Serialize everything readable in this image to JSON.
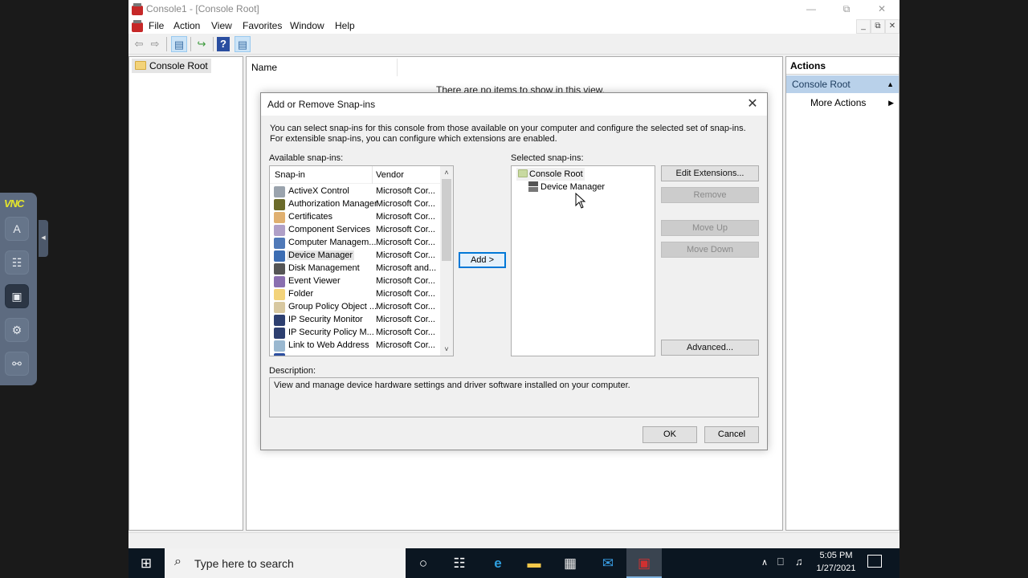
{
  "window": {
    "title": "Console1 - [Console Root]",
    "controls": {
      "minimize": "—",
      "restore": "⧉",
      "close": "✕"
    },
    "mdi_controls": {
      "minimize": "_",
      "restore": "⧉",
      "close": "✕"
    }
  },
  "menubar": [
    "File",
    "Action",
    "View",
    "Favorites",
    "Window",
    "Help"
  ],
  "toolbar": {
    "back": "⇦",
    "forward": "⇨",
    "show_hide_tree": "▤",
    "export": "↪",
    "help": "?",
    "show_hide_action": "▤"
  },
  "tree": {
    "root": "Console Root"
  },
  "results": {
    "column_name": "Name",
    "empty_message": "There are no items to show in this view."
  },
  "actions": {
    "header": "Actions",
    "group": "Console Root",
    "group_arrow": "▲",
    "more": "More Actions",
    "more_arrow": "▶"
  },
  "vnc": {
    "logo": "VNC",
    "buttons": [
      {
        "name": "keyboard",
        "glyph": "A"
      },
      {
        "name": "clipboard",
        "glyph": "☷"
      },
      {
        "name": "scale",
        "glyph": "▣"
      },
      {
        "name": "settings",
        "glyph": "⚙"
      },
      {
        "name": "disconnect",
        "glyph": "⚯"
      }
    ],
    "handle": "◀"
  },
  "dialog": {
    "title": "Add or Remove Snap-ins",
    "close": "✕",
    "intro": "You can select snap-ins for this console from those available on your computer and configure the selected set of snap-ins. For extensible snap-ins, you can configure which extensions are enabled.",
    "available_label": "Available snap-ins:",
    "selected_label": "Selected snap-ins:",
    "columns": {
      "snapin": "Snap-in",
      "vendor": "Vendor"
    },
    "available": [
      {
        "name": "ActiveX Control",
        "vendor": "Microsoft Cor...",
        "icon": "activex",
        "color": "#9aa3ad"
      },
      {
        "name": "Authorization Manager",
        "vendor": "Microsoft Cor...",
        "icon": "authorization",
        "color": "#6b6b2a"
      },
      {
        "name": "Certificates",
        "vendor": "Microsoft Cor...",
        "icon": "certificate",
        "color": "#e0b070"
      },
      {
        "name": "Component Services",
        "vendor": "Microsoft Cor...",
        "icon": "component",
        "color": "#b0a0c8"
      },
      {
        "name": "Computer Managem...",
        "vendor": "Microsoft Cor...",
        "icon": "computer",
        "color": "#4f79b8"
      },
      {
        "name": "Device Manager",
        "vendor": "Microsoft Cor...",
        "icon": "device",
        "color": "#3c6db3",
        "selected": true
      },
      {
        "name": "Disk Management",
        "vendor": "Microsoft and...",
        "icon": "disk",
        "color": "#555"
      },
      {
        "name": "Event Viewer",
        "vendor": "Microsoft Cor...",
        "icon": "event",
        "color": "#8a6fb0"
      },
      {
        "name": "Folder",
        "vendor": "Microsoft Cor...",
        "icon": "folder",
        "color": "#f3d37a"
      },
      {
        "name": "Group Policy Object ...",
        "vendor": "Microsoft Cor...",
        "icon": "policy",
        "color": "#d8c8a0"
      },
      {
        "name": "IP Security Monitor",
        "vendor": "Microsoft Cor...",
        "icon": "ipsec",
        "color": "#2d3f70"
      },
      {
        "name": "IP Security Policy M...",
        "vendor": "Microsoft Cor...",
        "icon": "ipsec-policy",
        "color": "#2d3f70"
      },
      {
        "name": "Link to Web Address",
        "vendor": "Microsoft Cor...",
        "icon": "link",
        "color": "#9ab8d0"
      }
    ],
    "scroll_up": "˄",
    "scroll_down": "˅",
    "add_button": "Add >",
    "selected": {
      "root": "Console Root",
      "children": [
        "Device Manager"
      ]
    },
    "buttons": {
      "edit_extensions": "Edit Extensions...",
      "remove": "Remove",
      "move_up": "Move Up",
      "move_down": "Move Down",
      "advanced": "Advanced..."
    },
    "description_label": "Description:",
    "description": "View and manage device hardware settings and driver software installed on your computer.",
    "ok": "OK",
    "cancel": "Cancel"
  },
  "taskbar": {
    "start": "⊞",
    "search_icon": "⌕",
    "search_placeholder": "Type here to search",
    "apps": [
      {
        "name": "cortana",
        "glyph": "○"
      },
      {
        "name": "task-view",
        "glyph": "☷"
      },
      {
        "name": "edge",
        "glyph": "e"
      },
      {
        "name": "file-explorer",
        "glyph": "▬"
      },
      {
        "name": "store",
        "glyph": "▦"
      },
      {
        "name": "mail",
        "glyph": "✉"
      },
      {
        "name": "mmc",
        "glyph": "▣",
        "active": true
      }
    ],
    "tray_up": "∧",
    "network": "⎕",
    "volume": "♫",
    "time": "5:05 PM",
    "date": "1/27/2021"
  }
}
